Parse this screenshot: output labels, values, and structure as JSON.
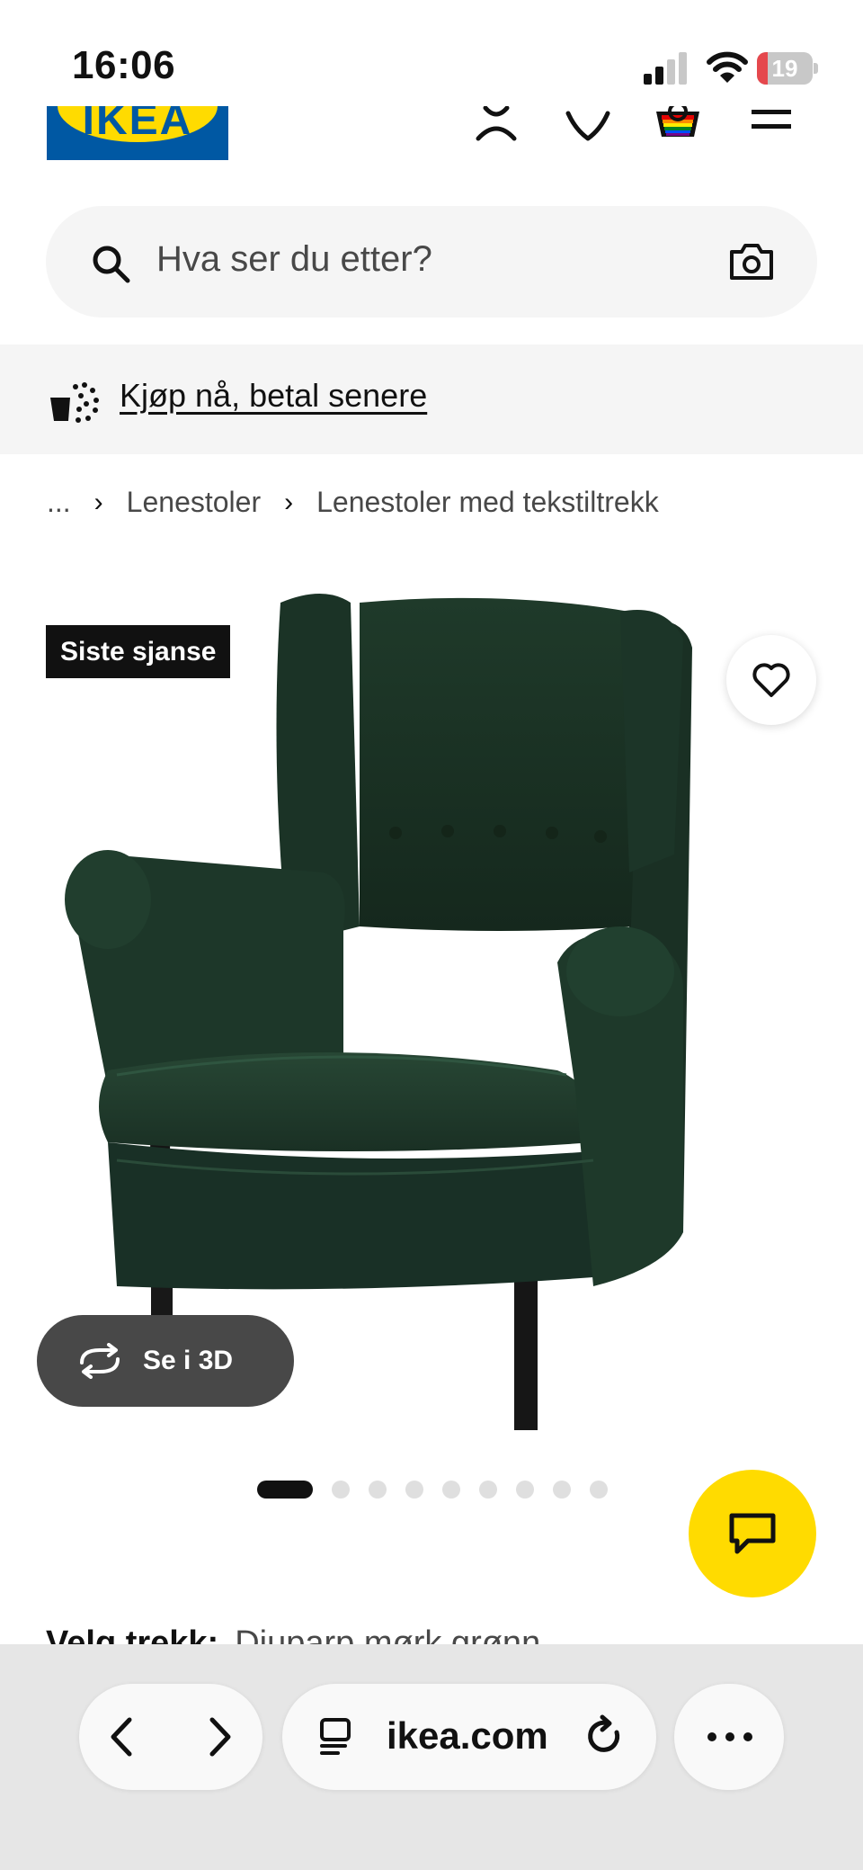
{
  "status_bar": {
    "time": "16:06",
    "battery_level": "19"
  },
  "header": {
    "logo_text": "IKEA"
  },
  "search": {
    "placeholder": "Hva ser du etter?"
  },
  "promo": {
    "link_text": "Kjøp nå, betal senere"
  },
  "breadcrumb": {
    "ellipsis": "...",
    "items": [
      "Lenestoler",
      "Lenestoler med tekstiltrekk"
    ]
  },
  "product": {
    "badge": "Siste sjanse",
    "view_3d_label": "Se i 3D",
    "carousel": {
      "total": 9,
      "active": 1
    },
    "fabric_label": "Velg trekk:",
    "fabric_value": "Djuparp mørk grønn"
  },
  "browser": {
    "url": "ikea.com"
  },
  "colors": {
    "ikea_blue": "#0058a3",
    "ikea_yellow": "#ffdb00",
    "badge_bg": "#111111",
    "chair_green": "#1f3a2a",
    "battery_red": "#e5484d"
  },
  "icons": [
    "signal-icon",
    "wifi-icon",
    "account-icon",
    "wishlist-icon",
    "bag-icon",
    "menu-icon",
    "search-icon",
    "camera-icon",
    "installment-icon",
    "heart-icon",
    "rotate-3d-icon",
    "chat-icon",
    "back-icon",
    "forward-icon",
    "tabs-icon",
    "reload-icon",
    "more-icon"
  ]
}
